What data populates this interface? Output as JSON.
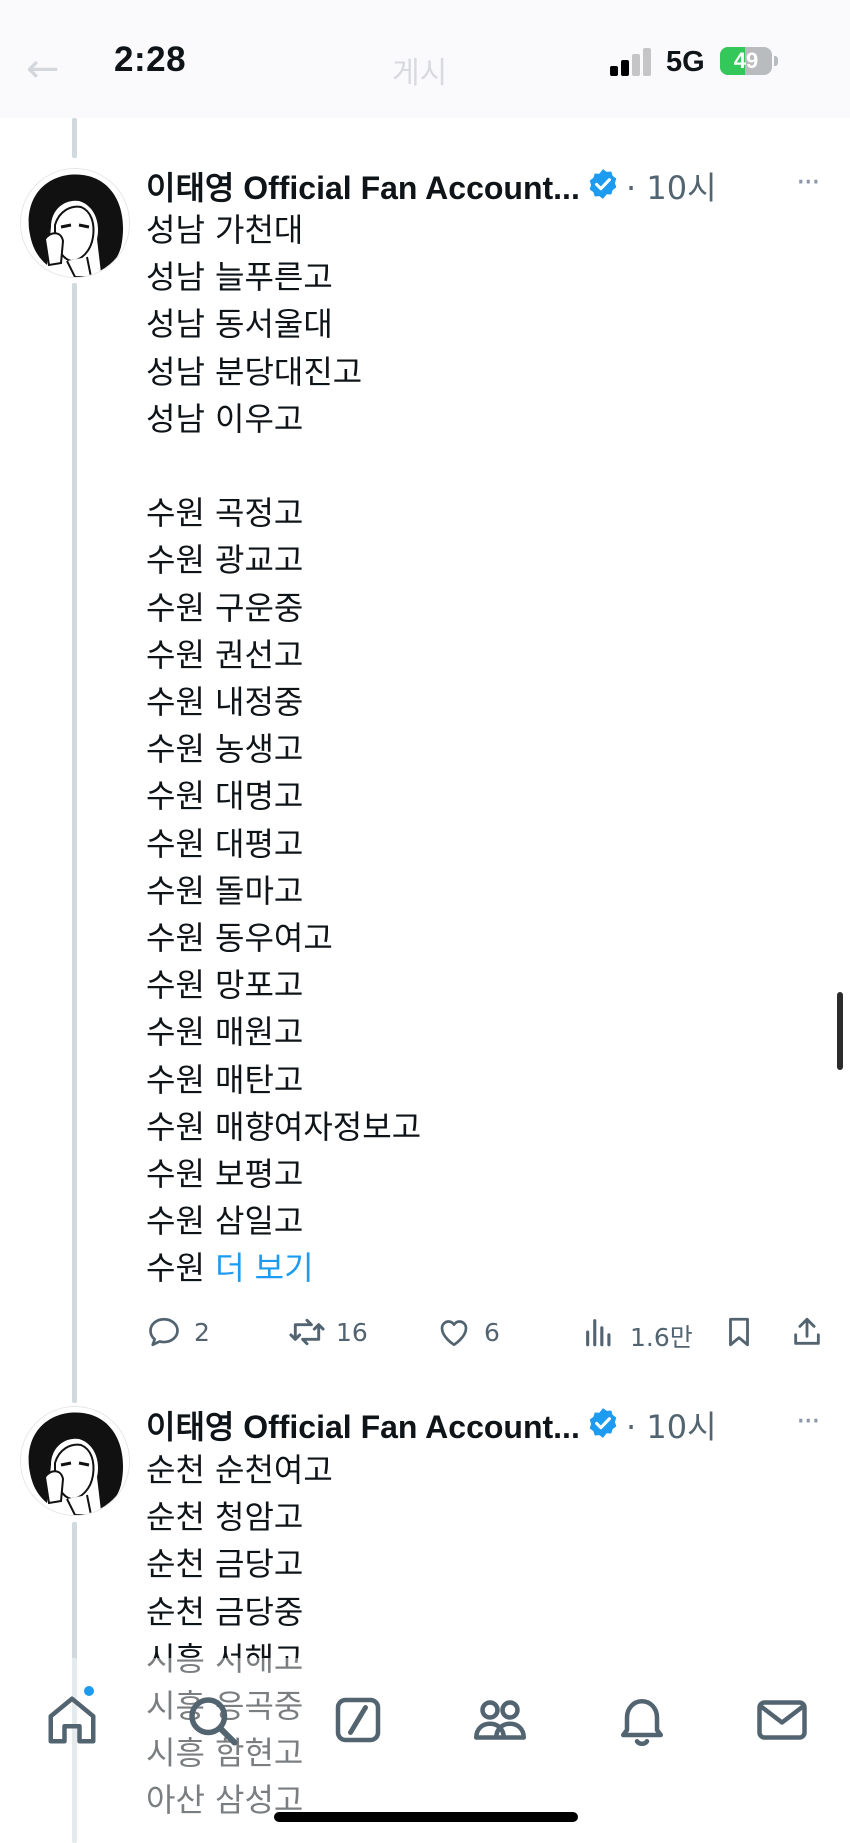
{
  "status_bar": {
    "time": "2:28",
    "network": "5G",
    "battery": "49",
    "battery_level": 0.49,
    "behind_title": "게시",
    "signal_bars_active": 2
  },
  "icons": {
    "verified": "verified-badge-icon",
    "more": "more-options-icon",
    "reply": "reply-icon",
    "retweet": "retweet-icon",
    "like": "like-icon",
    "views": "views-icon",
    "bookmark": "bookmark-icon",
    "share": "share-icon",
    "tabs": [
      "home-icon",
      "search-icon",
      "compose-icon",
      "communities-icon",
      "notifications-icon",
      "messages-icon"
    ]
  },
  "colors": {
    "accent": "#1d9bf0",
    "muted": "#536471",
    "thread_line": "#cfd9de"
  },
  "tweets": [
    {
      "author": "이태영 Official Fan Account...",
      "time": "· 10시",
      "more": "···",
      "text": "성남 가천대\n성남 늘푸른고\n성남 동서울대\n성남 분당대진고\n성남 이우고\n\n수원 곡정고\n수원 광교고\n수원 구운중\n수원 권선고\n수원 내정중\n수원 농생고\n수원 대명고\n수원 대평고\n수원 돌마고\n수원 동우여고\n수원 망포고\n수원 매원고\n수원 매탄고\n수원 매향여자정보고\n수원 보평고\n수원 삼일고\n수원 ",
      "show_more": "더 보기",
      "stats": {
        "replies": "2",
        "retweets": "16",
        "likes": "6",
        "views": "1.6만"
      }
    },
    {
      "author": "이태영 Official Fan Account...",
      "time": "· 10시",
      "more": "···",
      "text": "순천 순천여고\n순천 청암고\n순천 금당고\n순천 금당중\n시흥 서해고\n시흥 응곡중\n시흥 함현고\n아산 삼성고"
    }
  ]
}
